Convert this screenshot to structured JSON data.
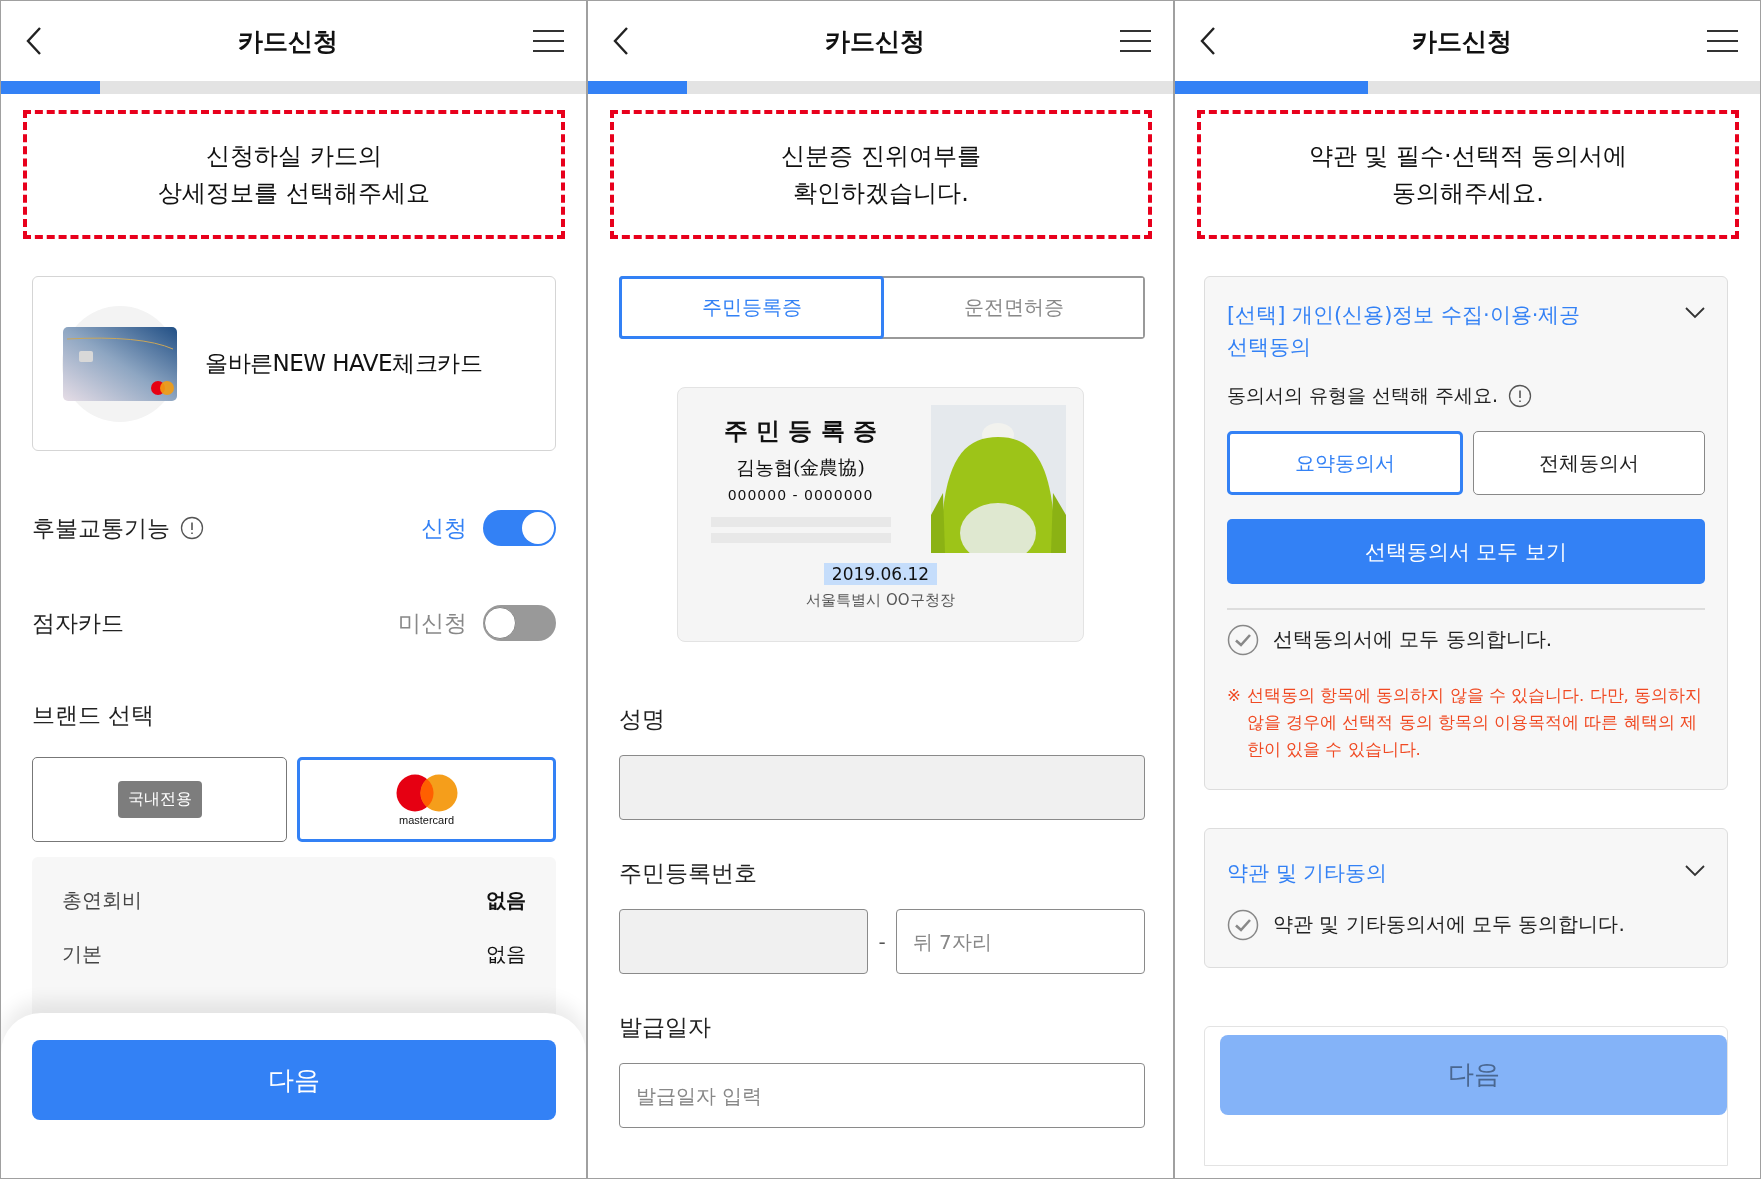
{
  "screens": [
    {
      "kind": "card_details",
      "title": "카드신청",
      "progress": {
        "level": 0.17
      },
      "notice": "신청하실 카드의\n상세정보를 선택해주세요",
      "card": {
        "name": "올바른NEW HAVE체크카드"
      },
      "options": [
        {
          "label": "후불교통기능",
          "info": true,
          "status": "신청",
          "on": true
        },
        {
          "label": "점자카드",
          "info": false,
          "status": "미신청",
          "on": false
        }
      ],
      "brand": {
        "title": "브랜드 선택",
        "options": [
          {
            "kind": "domestic",
            "label": "국내전용",
            "selected": false
          },
          {
            "kind": "mastercard",
            "label": "mastercard",
            "selected": true
          }
        ]
      },
      "fees": [
        {
          "label": "총연회비",
          "value": "없음",
          "emphasized": true
        },
        {
          "label": "기본",
          "value": "없음",
          "emphasized": false
        }
      ],
      "next_button": {
        "label": "다음",
        "disabled": false
      }
    },
    {
      "kind": "identity",
      "title": "카드신청",
      "progress": {
        "level": 0.17
      },
      "notice": "신분증 진위여부를\n확인하겠습니다.",
      "tabs": [
        {
          "label": "주민등록증",
          "selected": true
        },
        {
          "label": "운전면허증",
          "selected": false
        }
      ],
      "id_card": {
        "title": "주 민 등 록 증",
        "name": "김농협(金農協)",
        "number": "000000 - 0000000",
        "issue_date": "2019.06.12",
        "issuer": "서울특별시 OO구청장"
      },
      "fields": [
        {
          "label": "성명",
          "inputs": [
            {
              "disabled": true
            }
          ]
        },
        {
          "label": "주민등록번호",
          "separator": "-",
          "inputs": [
            {
              "disabled": true
            },
            {
              "placeholder": "뒤 7자리",
              "disabled": false
            }
          ]
        },
        {
          "label": "발급일자",
          "inputs": [
            {
              "placeholder": "발급일자 입력",
              "disabled": false
            }
          ]
        }
      ]
    },
    {
      "kind": "terms",
      "title": "카드신청",
      "progress": {
        "level": 0.33
      },
      "notice": "약관 및 필수·선택적 동의서에\n동의해주세요.",
      "sections": [
        {
          "title": "[선택] 개인(신용)정보 수집·이용·제공\n선택동의",
          "prompt": "동의서의 유형을 선택해 주세요.",
          "types": [
            {
              "label": "요약동의서",
              "selected": true
            },
            {
              "label": "전체동의서",
              "selected": false
            }
          ],
          "view_button": "선택동의서 모두 보기",
          "agree": {
            "label": "선택동의서에 모두 동의합니다.",
            "checked": false
          },
          "note_mark": "※",
          "note": "선택동의 항목에 동의하지 않을 수 있습니다. 다만, 동의하지 않을 경우에 선택적 동의 항목의 이용목적에 따른 혜택의 제한이 있을 수 있습니다."
        },
        {
          "title": "약관 및 기타동의",
          "agree": {
            "label": "약관 및 기타동의서에 모두 동의합니다.",
            "checked": false
          }
        }
      ],
      "next_button": {
        "label": "다음",
        "disabled": true
      }
    }
  ]
}
